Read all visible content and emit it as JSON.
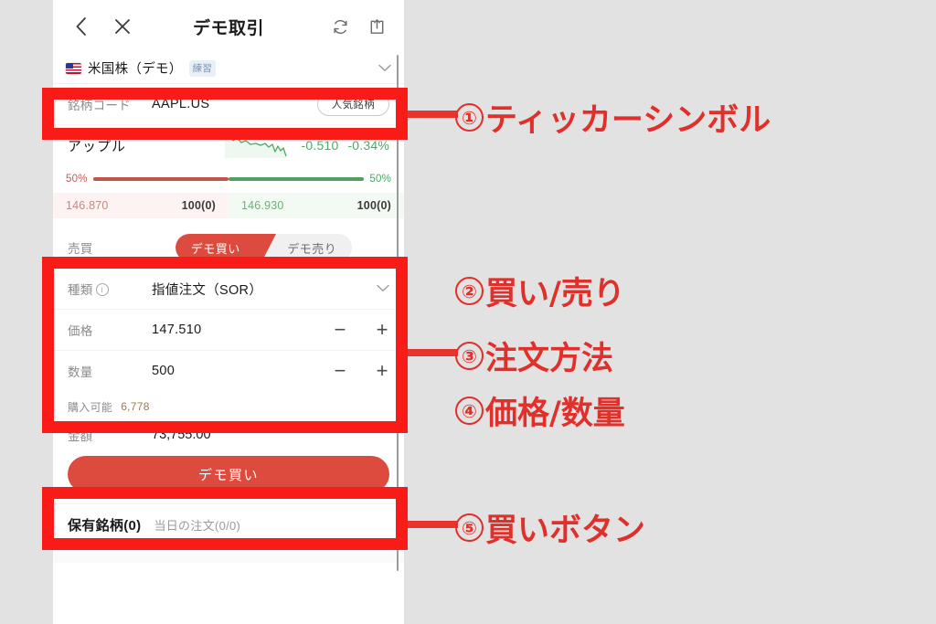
{
  "header": {
    "title": "デモ取引",
    "back_icon": "chevron-left-icon",
    "close_icon": "close-icon",
    "refresh_icon": "refresh-icon",
    "share_icon": "share-icon"
  },
  "market": {
    "flag": "us-flag-icon",
    "name": "米国株（デモ）",
    "badge": "練習",
    "chevron": "chevron-down-icon"
  },
  "ticker": {
    "label": "銘柄コード",
    "value": "AAPL.US",
    "pill": "人気銘柄"
  },
  "stock": {
    "name": "アップル",
    "change": "-0.510",
    "change_pct": "-0.34%",
    "sparkline_color": "#4aab63"
  },
  "depth": {
    "left_pct": "50%",
    "right_pct": "50%",
    "bid_price": "146.870",
    "bid_size": "100(0)",
    "ask_price": "146.930",
    "ask_size": "100(0)",
    "bid_color": "#c0544c",
    "ask_color": "#4fa05c"
  },
  "order": {
    "side_label": "売買",
    "side_buy": "デモ買い",
    "side_sell": "デモ売り",
    "side_selected": "デモ買い",
    "type_label": "種類",
    "type_value": "指値注文（SOR）",
    "price_label": "価格",
    "price_value": "147.510",
    "qty_label": "数量",
    "qty_value": "500",
    "minus": "−",
    "plus": "+",
    "accent_color": "#dd4b3e"
  },
  "summary": {
    "available_label": "購入可能",
    "available_value": "6,778",
    "amount_label": "金額",
    "amount_value": "73,755.00"
  },
  "submit": {
    "label": "デモ買い"
  },
  "bottom_tabs": [
    {
      "label": "保有銘柄(0)",
      "active": true
    },
    {
      "label": "当日の注文(0/0)",
      "active": false
    }
  ],
  "annotations": [
    {
      "num": "①",
      "text": "ティッカーシンボル"
    },
    {
      "num": "②",
      "text": "買い/売り"
    },
    {
      "num": "③",
      "text": "注文方法"
    },
    {
      "num": "④",
      "text": "価格/数量"
    },
    {
      "num": "⑤",
      "text": "買いボタン"
    }
  ],
  "annotation_color": "#e0302b",
  "highlight_box_color": "#f81b18",
  "background_color": "#e2e2e2"
}
